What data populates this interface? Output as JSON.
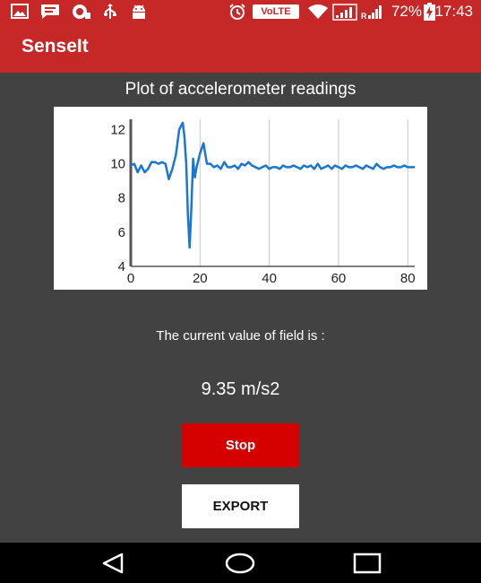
{
  "status_bar": {
    "volte": "VoLTE",
    "battery_percent": "72%",
    "time": "17:43"
  },
  "app_bar": {
    "title": "SenseIt"
  },
  "plot": {
    "title": "Plot of accelerometer readings"
  },
  "chart_data": {
    "type": "line",
    "title": "Plot of accelerometer readings",
    "xlabel": "",
    "ylabel": "",
    "xlim": [
      0,
      82
    ],
    "ylim": [
      4,
      12.6
    ],
    "x_ticks": [
      0,
      20,
      40,
      60,
      80
    ],
    "y_ticks": [
      4,
      6,
      8,
      10,
      12
    ],
    "grid": "vertical",
    "color": "#1976d2",
    "series": [
      {
        "x": [
          0,
          1,
          2,
          3,
          4,
          5,
          6,
          7,
          8,
          9,
          10,
          11,
          12,
          13,
          14,
          15,
          15.5,
          16,
          16.5,
          17,
          17.5,
          18,
          18.5,
          19,
          20,
          21,
          22,
          23,
          24,
          25,
          26,
          27,
          28,
          29,
          30,
          31,
          32,
          33,
          34,
          35,
          36,
          37,
          38,
          39,
          40,
          41,
          42,
          43,
          44,
          45,
          46,
          47,
          48,
          49,
          50,
          51,
          52,
          53,
          54,
          55,
          56,
          57,
          58,
          59,
          60,
          61,
          62,
          63,
          64,
          65,
          66,
          67,
          68,
          69,
          70,
          71,
          72,
          73,
          74,
          75,
          76,
          77,
          78,
          79,
          80,
          81,
          82
        ],
        "y": [
          9.9,
          10.0,
          9.5,
          9.9,
          9.5,
          9.7,
          10.1,
          10.1,
          10.0,
          10.1,
          10.0,
          9.1,
          9.7,
          10.5,
          12.0,
          12.4,
          11.6,
          10.0,
          7.0,
          5.1,
          7.5,
          10.3,
          9.2,
          9.8,
          10.6,
          11.2,
          10.0,
          10.0,
          9.8,
          9.9,
          9.7,
          10.1,
          9.8,
          9.8,
          9.9,
          9.7,
          10.0,
          9.9,
          10.1,
          9.9,
          9.8,
          9.7,
          9.8,
          9.9,
          9.7,
          9.8,
          9.8,
          9.7,
          9.9,
          9.8,
          9.8,
          9.9,
          9.8,
          9.7,
          9.9,
          9.8,
          9.9,
          9.7,
          10.0,
          9.7,
          9.8,
          9.9,
          9.7,
          9.9,
          9.8,
          9.7,
          9.9,
          9.8,
          9.8,
          9.9,
          9.8,
          9.7,
          9.9,
          9.8,
          9.7,
          10.0,
          9.8,
          9.7,
          9.8,
          9.8,
          9.9,
          9.8,
          9.8,
          9.9,
          9.8,
          9.8,
          9.8
        ]
      }
    ]
  },
  "field": {
    "label": "The current value of field is :",
    "value": "9.35 m/s2"
  },
  "buttons": {
    "stop": "Stop",
    "export": "EXPORT"
  },
  "icons": {
    "status_left": [
      "image-icon",
      "message-icon",
      "whatsapp-icon",
      "usb-icon",
      "android-icon"
    ],
    "status_right": [
      "alarm-icon",
      "wifi-icon",
      "signal-icon",
      "battery-charging-icon"
    ],
    "nav": [
      "back-icon",
      "home-icon",
      "recents-icon"
    ]
  }
}
